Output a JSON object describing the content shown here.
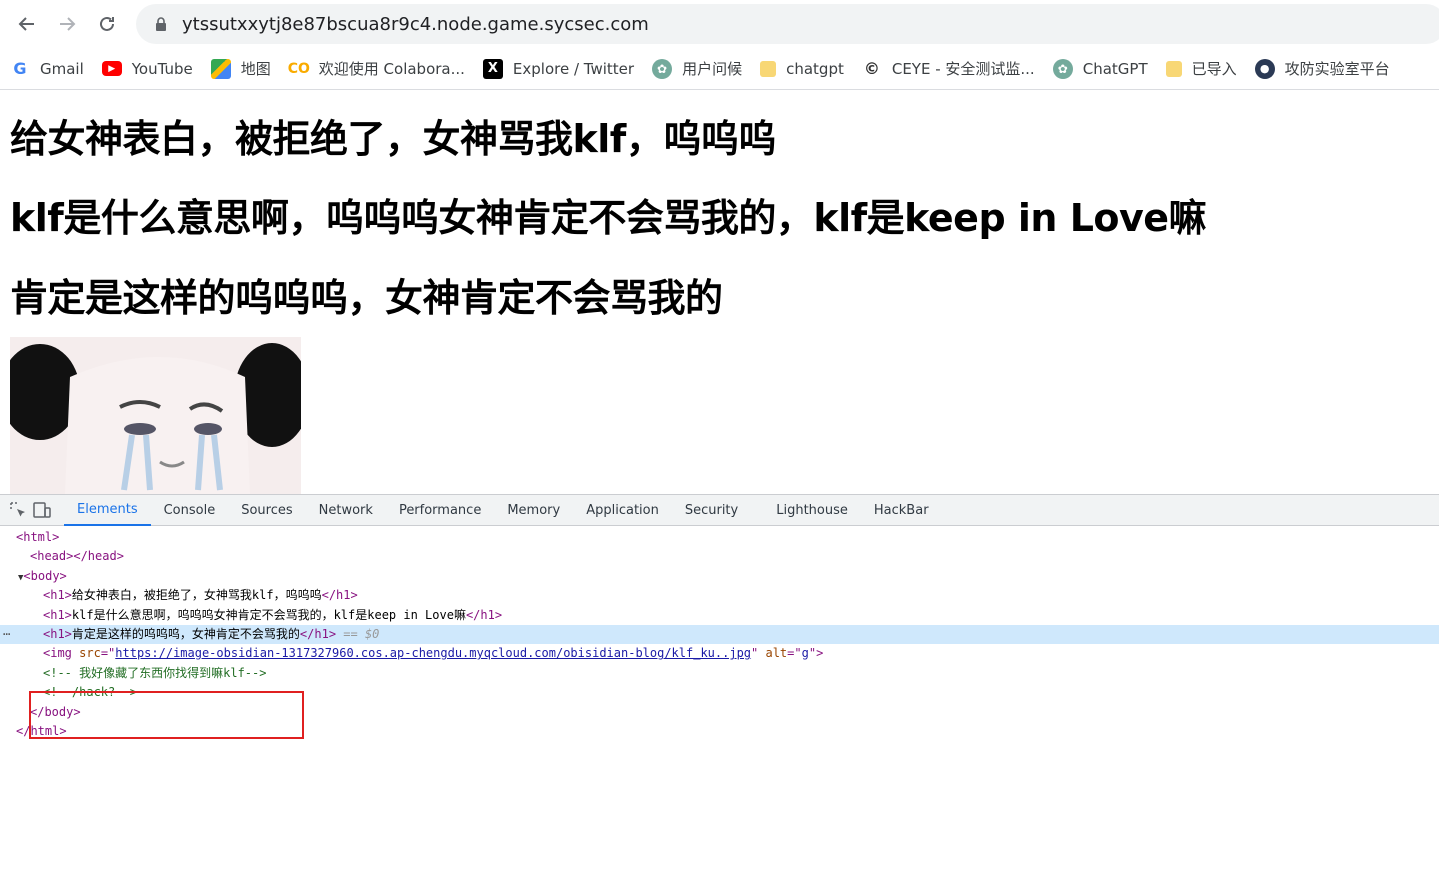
{
  "browser": {
    "url": "ytssutxxytj8e87bscua8r9c4.node.game.sycsec.com",
    "bookmarks": [
      {
        "label": "Gmail",
        "icon": "google-icon"
      },
      {
        "label": "YouTube",
        "icon": "youtube-icon"
      },
      {
        "label": "地图",
        "icon": "maps-icon"
      },
      {
        "label": "欢迎使用 Colabora...",
        "icon": "colab-icon"
      },
      {
        "label": "Explore / Twitter",
        "icon": "x-icon"
      },
      {
        "label": "用户问候",
        "icon": "openai-icon"
      },
      {
        "label": "chatgpt",
        "icon": "folder-icon"
      },
      {
        "label": "CEYE - 安全测试监...",
        "icon": "ceye-icon"
      },
      {
        "label": "ChatGPT",
        "icon": "openai-icon"
      },
      {
        "label": "已导入",
        "icon": "folder-icon"
      },
      {
        "label": "攻防实验室平台",
        "icon": "spy-icon"
      }
    ]
  },
  "page": {
    "h1_1": "给女神表白，被拒绝了，女神骂我klf，呜呜呜",
    "h1_2": "klf是什么意思啊，呜呜呜女神肯定不会骂我的，klf是keep in Love嘛",
    "h1_3": "肯定是这样的呜呜呜，女神肯定不会骂我的"
  },
  "devtools": {
    "tabs": [
      "Elements",
      "Console",
      "Sources",
      "Network",
      "Performance",
      "Memory",
      "Application",
      "Security",
      "Lighthouse",
      "HackBar"
    ],
    "active_tab": "Elements",
    "dom": {
      "html_open": "<html>",
      "head": "<head></head>",
      "body_open": "<body>",
      "h1_open": "<h1>",
      "h1_close": "</h1>",
      "h1_text_1": "给女神表白，被拒绝了，女神骂我klf，呜呜呜",
      "h1_text_2": "klf是什么意思啊，呜呜呜女神肯定不会骂我的，klf是keep in Love嘛",
      "h1_text_3": "肯定是这样的呜呜呜，女神肯定不会骂我的",
      "selected_marker": "== $0",
      "img_tag": "<img ",
      "img_src_attr": "src",
      "img_src": "https://image-obsidian-1317327960.cos.ap-chengdu.myqcloud.com/obisidian-blog/klf_ku..jpg",
      "img_alt_attr": "alt",
      "img_alt": "g",
      "comment_1": "<!-- 我好像藏了东西你找得到嘛klf-->",
      "comment_2": "<!--/hack?-->",
      "body_close": "</body>",
      "html_close": "</html>"
    }
  },
  "colors": {
    "accent": "#1a73e8",
    "tag": "#881280",
    "comment": "#236e25",
    "highlight_box": "#e02020",
    "selected_row": "#cfe8fc"
  }
}
